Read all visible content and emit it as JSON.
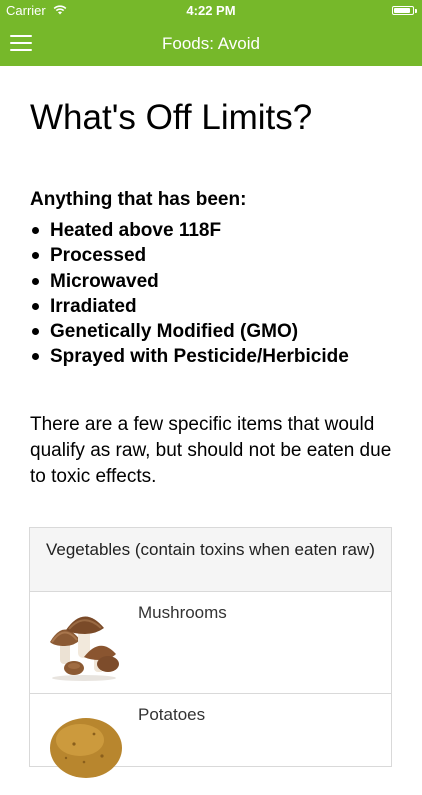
{
  "status_bar": {
    "carrier": "Carrier",
    "time": "4:22 PM",
    "battery_level_percent": 100
  },
  "nav": {
    "title": "Foods: Avoid",
    "menu_icon": "hamburger-menu-icon"
  },
  "colors": {
    "brand_green": "#76b82a",
    "card_header_bg": "#f5f5f5",
    "border": "#d9d9d9"
  },
  "page": {
    "title": "What's Off Limits?",
    "sub_heading": "Anything that has been:",
    "criteria": [
      "Heated above 118F",
      "Processed",
      "Microwaved",
      "Irradiated",
      "Genetically Modified (GMO)",
      "Sprayed with Pesticide/Herbicide"
    ],
    "intro": "There are a few specific items that would qualify as raw, but should not be eaten due to toxic effects."
  },
  "vegetables": {
    "header": "Vegetables (contain toxins when eaten raw)",
    "items": [
      {
        "name": "Mushrooms",
        "icon": "mushrooms-image"
      },
      {
        "name": "Potatoes",
        "icon": "potato-image"
      }
    ]
  }
}
